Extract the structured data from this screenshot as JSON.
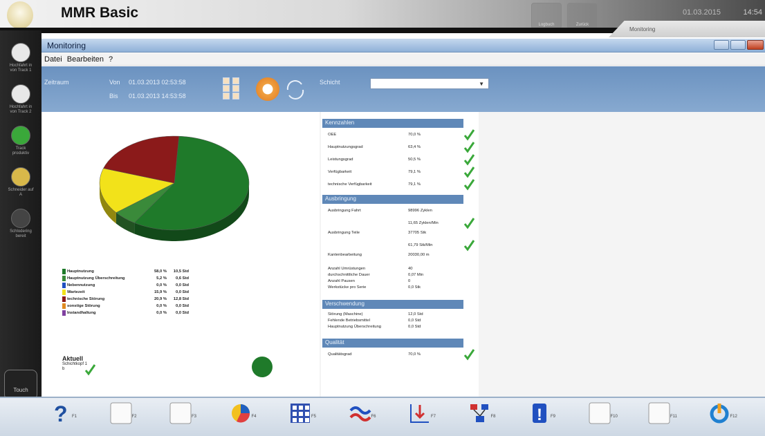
{
  "app": {
    "title": "MMR Basic",
    "date": "01.03.2015",
    "time": "14:54",
    "tab_monitoring": "Monitoring",
    "banner_buttons": [
      {
        "label": "Logbuch"
      },
      {
        "label": "Zurück"
      }
    ]
  },
  "sidebar": {
    "items": [
      {
        "label": "Hochfahrt in\nvon Track 1",
        "icon": "machine-icon",
        "color": "#e8e8e8"
      },
      {
        "label": "Hochfahrt in\nvon Track 2",
        "icon": "machine-icon",
        "color": "#e8e8e8"
      },
      {
        "label": "Track\nproduktiv",
        "icon": "status-green-icon",
        "color": "#3aa83a"
      },
      {
        "label": "Schneider auf\nA",
        "icon": "status-yellow-icon",
        "color": "#d8b84a"
      },
      {
        "label": "Schlodering\nbereit",
        "icon": "board-icon",
        "color": "#444"
      }
    ],
    "touch_label": "Touch"
  },
  "window": {
    "title": "Monitoring",
    "menu": [
      "Datei",
      "Bearbeiten",
      "?"
    ]
  },
  "filter": {
    "zeitraum_label": "Zeitraum",
    "von_label": "Von",
    "von_value": "01.03.2013 02:53:58",
    "bis_label": "Bis",
    "bis_value": "01.03.2013 14:53:58",
    "schicht_label": "Schicht",
    "schicht_value": ""
  },
  "colors": {
    "green": "#1f7a2a",
    "dark_red": "#8b1a1a",
    "yellow": "#f2e21a",
    "blue": "#2050c0",
    "orange": "#e08a20",
    "purple": "#8040a0",
    "header_blue": "#5f88b8",
    "check_green": "#3aa83a"
  },
  "chart_data": {
    "type": "pie",
    "title": "",
    "slices": [
      {
        "name": "Hauptnutzung",
        "value": 58.0,
        "color": "#1f7a2a"
      },
      {
        "name": "Hauptnutzung Überschreitung",
        "value": 5.2,
        "color": "#3a8a3a"
      },
      {
        "name": "Nebennutzung",
        "value": 0.0,
        "color": "#2050c0"
      },
      {
        "name": "Wartezeit",
        "value": 15.9,
        "color": "#f2e21a"
      },
      {
        "name": "technische Störung",
        "value": 20.9,
        "color": "#8b1a1a"
      },
      {
        "name": "sonstige Störung",
        "value": 0.0,
        "color": "#e08a20"
      },
      {
        "name": "Instandhaltung",
        "value": 0.0,
        "color": "#8040a0"
      }
    ]
  },
  "legend": [
    {
      "name": "Hauptnutzung",
      "pct": "58,0 %",
      "dur": "10,5 Std",
      "color": "#1f7a2a"
    },
    {
      "name": "Hauptnutzung Überschreitung",
      "pct": "5,2 %",
      "dur": "0,6 Std",
      "color": "#3a8a3a"
    },
    {
      "name": "Nebennutzung",
      "pct": "0,0 %",
      "dur": "0,0 Std",
      "color": "#2050c0"
    },
    {
      "name": "Wartezeit",
      "pct": "15,9 %",
      "dur": "0,0 Std",
      "color": "#f2e21a"
    },
    {
      "name": "technische Störung",
      "pct": "20,9 %",
      "dur": "12,8 Std",
      "color": "#8b1a1a"
    },
    {
      "name": "sonstige Störung",
      "pct": "0,0 %",
      "dur": "0,0 Std",
      "color": "#e08a20"
    },
    {
      "name": "Instandhaltung",
      "pct": "0,0 %",
      "dur": "0,0 Std",
      "color": "#8040a0"
    }
  ],
  "aktuell": {
    "title": "Aktuell",
    "sub": "Schichtkopf 1\nb"
  },
  "kennzahlen": {
    "header": "Kennzahlen",
    "rows": [
      {
        "k": "OEE",
        "v": "70,0 %"
      },
      {
        "k": "Hauptnutzungsgrad",
        "v": "63,4 %"
      },
      {
        "k": "Leistungsgrad",
        "v": "50,5 %"
      },
      {
        "k": "Verfügbarkeit",
        "v": "79,1 %"
      },
      {
        "k": "technische Verfügbarkeit",
        "v": "79,1 %"
      }
    ]
  },
  "ausbringung": {
    "header": "Ausbringung",
    "rows": [
      {
        "k": "Ausbringung Fahrt",
        "v": "98996 Zyklen"
      },
      {
        "k": "",
        "v": "11,65 Zyklen/Min"
      },
      {
        "k": "Ausbringung Teile",
        "v": "37705 Stk"
      },
      {
        "k": "",
        "v": "61,79 Stk/Min"
      },
      {
        "k": "Kantenbearbeitung",
        "v": "20030,00 m"
      },
      {
        "k": "Anzahl Umrüstungen",
        "v": "40"
      },
      {
        "k": "durchschnittliche Dauer",
        "v": "0,07 Min"
      },
      {
        "k": "Anzahl Pausen",
        "v": "0"
      },
      {
        "k": "Werkstücke pro Serie",
        "v": "0,0 Stk"
      }
    ]
  },
  "verschwendung": {
    "header": "Verschwendung",
    "rows": [
      {
        "k": "Störung (Maschine)",
        "v": "12,0 Std"
      },
      {
        "k": "Fehlende Betriebsmittel",
        "v": "0,0 Std"
      },
      {
        "k": "Hauptnutzung Überschreitung",
        "v": "0,0 Std"
      }
    ]
  },
  "qualitaet": {
    "header": "Qualität",
    "rows": [
      {
        "k": "Qualitätsgrad",
        "v": "70,0 %"
      }
    ]
  },
  "fkeys": [
    {
      "label": "F1",
      "icon": "help-icon"
    },
    {
      "label": "F2",
      "icon": "empty-icon"
    },
    {
      "label": "F3",
      "icon": "empty-icon"
    },
    {
      "label": "F4",
      "icon": "piechart-icon"
    },
    {
      "label": "F5",
      "icon": "grid-icon"
    },
    {
      "label": "F6",
      "icon": "waves-icon"
    },
    {
      "label": "F7",
      "icon": "trend-down-icon"
    },
    {
      "label": "F8",
      "icon": "hierarchy-icon"
    },
    {
      "label": "F9",
      "icon": "alert-icon"
    },
    {
      "label": "F10",
      "icon": "empty-icon"
    },
    {
      "label": "F11",
      "icon": "empty-icon"
    },
    {
      "label": "F12",
      "icon": "power-icon"
    }
  ]
}
